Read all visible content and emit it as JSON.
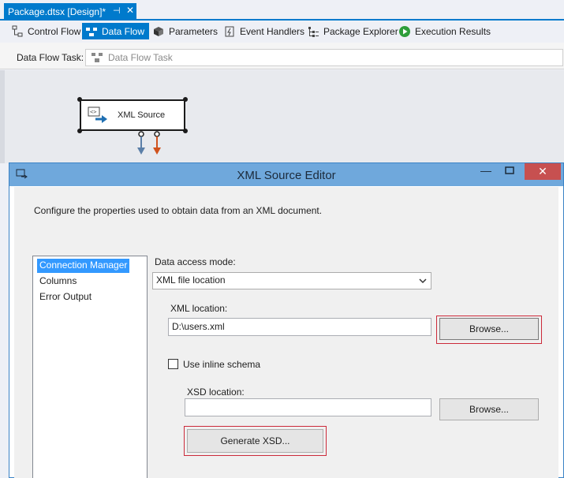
{
  "document_tab": {
    "title": "Package.dtsx [Design]*",
    "pin_glyph": "⊣",
    "close_glyph": "✕"
  },
  "designer_tabs": [
    {
      "label": "Control Flow"
    },
    {
      "label": "Data Flow"
    },
    {
      "label": "Parameters"
    },
    {
      "label": "Event Handlers"
    },
    {
      "label": "Package Explorer"
    },
    {
      "label": "Execution Results"
    }
  ],
  "task_bar": {
    "label": "Data Flow Task:",
    "value": "Data Flow Task"
  },
  "canvas": {
    "component_label": "XML Source"
  },
  "dialog": {
    "title": "XML Source Editor",
    "description": "Configure the properties used to obtain data from an XML document.",
    "nav": [
      "Connection Manager",
      "Columns",
      "Error Output"
    ],
    "data_access_mode_label": "Data access mode:",
    "data_access_mode_value": "XML file location",
    "xml_location_label": "XML location:",
    "xml_location_value": "D:\\users.xml",
    "browse_label": "Browse...",
    "inline_schema_label": "Use inline schema",
    "xsd_location_label": "XSD location:",
    "xsd_location_value": "",
    "xsd_browse_label": "Browse...",
    "generate_xsd_label": "Generate XSD...",
    "close_glyph": "✕",
    "min_glyph": "—"
  },
  "colors": {
    "accent": "#007acc",
    "dialog_title": "#6fa8dc",
    "highlight_box": "#cc2a3a",
    "close": "#c75050"
  }
}
